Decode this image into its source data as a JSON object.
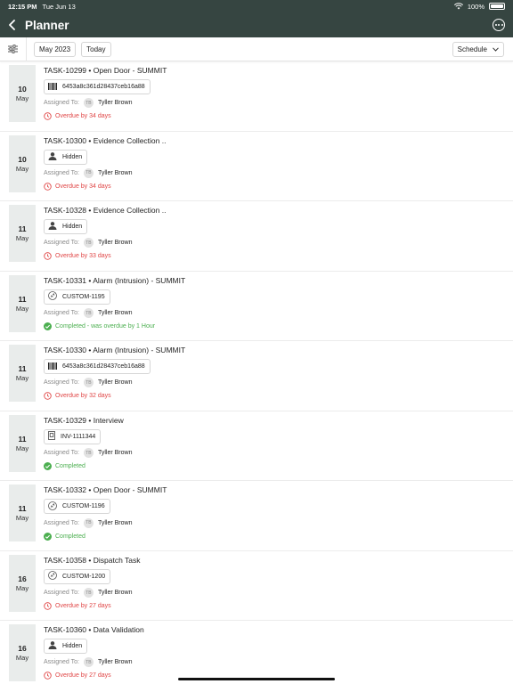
{
  "status_bar": {
    "time": "12:15 PM",
    "date": "Tue Jun 13",
    "battery": "100%"
  },
  "nav": {
    "title": "Planner"
  },
  "toolbar": {
    "month": "May 2023",
    "today": "Today",
    "view": "Schedule"
  },
  "tasks": [
    {
      "day": "10",
      "month": "May",
      "title": "TASK-10299 • Open Door - SUMMIT",
      "chip_icon": "barcode-icon",
      "chip": "6453a8c361d28437ceb16a88",
      "assigned_label": "Assigned To:",
      "initials": "TB",
      "assignee": "Tyller Brown",
      "status_type": "overdue",
      "status": "Overdue by 34 days"
    },
    {
      "day": "10",
      "month": "May",
      "title": "TASK-10300 • Evidence Collection ..",
      "chip_icon": "person-icon",
      "chip": "Hidden",
      "assigned_label": "Assigned To:",
      "initials": "TB",
      "assignee": "Tyller Brown",
      "status_type": "overdue",
      "status": "Overdue by 34 days"
    },
    {
      "day": "11",
      "month": "May",
      "title": "TASK-10328 • Evidence Collection ..",
      "chip_icon": "person-icon",
      "chip": "Hidden",
      "assigned_label": "Assigned To:",
      "initials": "TB",
      "assignee": "Tyller Brown",
      "status_type": "overdue",
      "status": "Overdue by 33 days"
    },
    {
      "day": "11",
      "month": "May",
      "title": "TASK-10331 • Alarm (Intrusion) - SUMMIT",
      "chip_icon": "link-icon",
      "chip": "CUSTOM-1195",
      "assigned_label": "Assigned To:",
      "initials": "TB",
      "assignee": "Tyller Brown",
      "status_type": "ok",
      "status": "Completed - was overdue by 1 Hour"
    },
    {
      "day": "11",
      "month": "May",
      "title": "TASK-10330 • Alarm (Intrusion) - SUMMIT",
      "chip_icon": "barcode-icon",
      "chip": "6453a8c361d28437ceb16a88",
      "assigned_label": "Assigned To:",
      "initials": "TB",
      "assignee": "Tyller Brown",
      "status_type": "overdue",
      "status": "Overdue by 32 days"
    },
    {
      "day": "11",
      "month": "May",
      "title": "TASK-10329 • Interview",
      "chip_icon": "document-icon",
      "chip": "INV-1111344",
      "assigned_label": "Assigned To:",
      "initials": "TB",
      "assignee": "Tyller Brown",
      "status_type": "ok",
      "status": "Completed"
    },
    {
      "day": "11",
      "month": "May",
      "title": "TASK-10332 • Open Door - SUMMIT",
      "chip_icon": "link-icon",
      "chip": "CUSTOM-1196",
      "assigned_label": "Assigned To:",
      "initials": "TB",
      "assignee": "Tyller Brown",
      "status_type": "ok",
      "status": "Completed"
    },
    {
      "day": "16",
      "month": "May",
      "title": "TASK-10358 • Dispatch Task",
      "chip_icon": "link-icon",
      "chip": "CUSTOM-1200",
      "assigned_label": "Assigned To:",
      "initials": "TB",
      "assignee": "Tyller Brown",
      "status_type": "overdue",
      "status": "Overdue by 27 days"
    },
    {
      "day": "16",
      "month": "May",
      "title": "TASK-10360 • Data Validation",
      "chip_icon": "person-icon",
      "chip": "Hidden",
      "assigned_label": "Assigned To:",
      "initials": "TB",
      "assignee": "Tyller Brown",
      "status_type": "overdue",
      "status": "Overdue by 27 days"
    }
  ],
  "colors": {
    "header": "#364541",
    "overdue": "#e04646",
    "completed": "#4caf50",
    "date_bg": "#e9eceb"
  }
}
